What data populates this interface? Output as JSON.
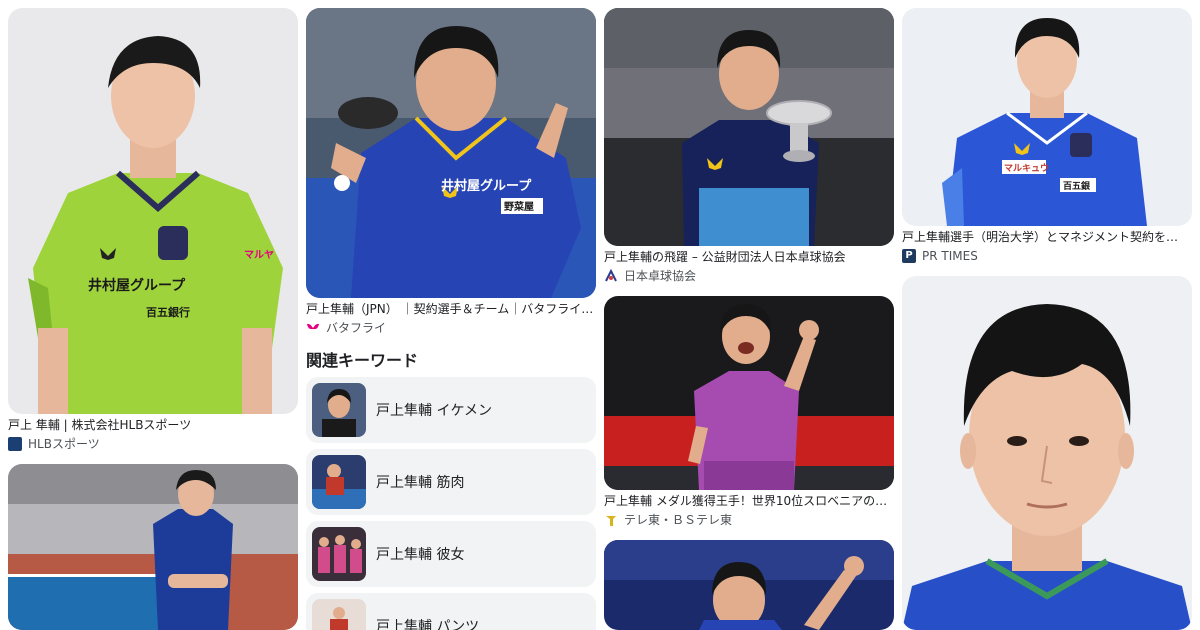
{
  "results": {
    "r1": {
      "caption": "戸上 隼輔 | 株式会社HLBスポーツ",
      "source": "HLBスポーツ",
      "jersey_text": "井村屋グループ",
      "sponsor": "百五銀行",
      "sleeve": "マルヤ"
    },
    "r2": {
      "caption": "戸上隼輔（JPN） ｜契約選手＆チーム｜バタフライ…",
      "source": "バタフライ",
      "jersey_text": "井村屋グループ",
      "sponsor": "野菜屋"
    },
    "r3": {
      "caption": "戸上隼輔の飛躍 – 公益財団法人日本卓球協会",
      "source": "日本卓球協会"
    },
    "r4": {
      "caption": "戸上隼輔選手（明治大学）とマネジメント契約を…",
      "source": "PR TIMES",
      "chest": "マルキュウ",
      "sponsor": "百五銀"
    },
    "r5": {
      "caption": "戸上隼輔 メダル獲得王手！世界10位スロベニアの…",
      "source": "テレ東・ＢＳテレ東"
    }
  },
  "related": {
    "title": "関連キーワード",
    "items": [
      {
        "label": "戸上隼輔 イケメン"
      },
      {
        "label": "戸上隼輔 筋肉"
      },
      {
        "label": "戸上隼輔 彼女"
      },
      {
        "label": "戸上隼輔 パンツ"
      }
    ]
  },
  "colors": {
    "butterfly_pink": "#e4007f",
    "jersey_blue": "#1e3fa8",
    "jersey_green": "#a8d63a",
    "caption": "#202124",
    "source": "#4d5156"
  }
}
